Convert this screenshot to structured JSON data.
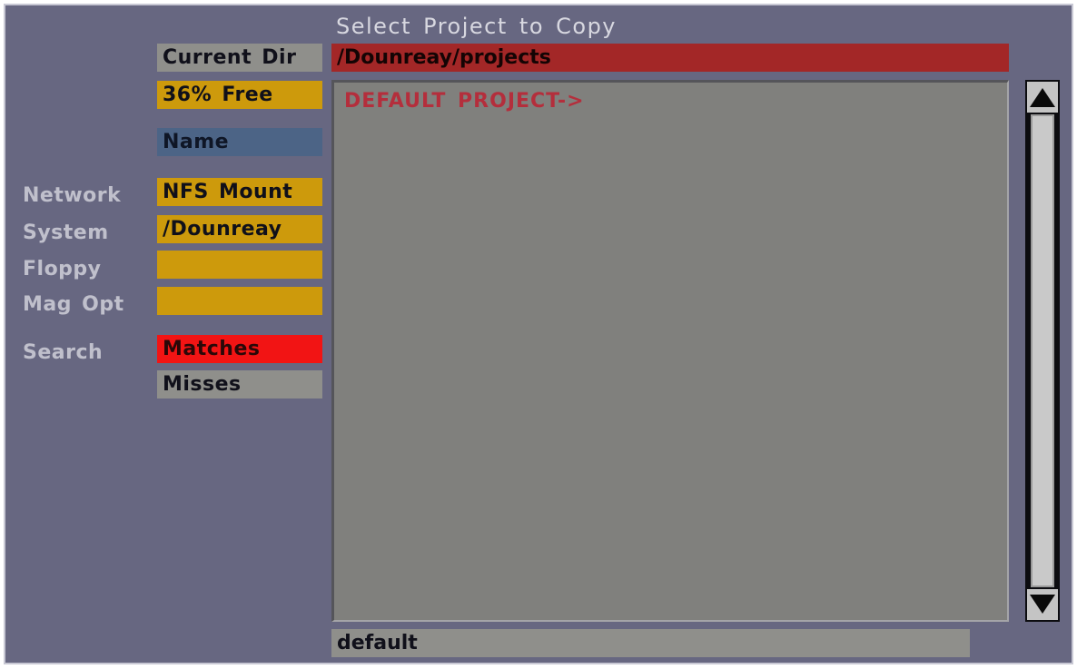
{
  "dialog": {
    "title": "Select Project to Copy",
    "current_dir_button": "Current Dir",
    "free_space": "36% Free",
    "name_button": "Name",
    "current_path": "/Dounreay/projects",
    "filename_value": "default"
  },
  "devices": [
    {
      "label": "Network",
      "value": "NFS Mount"
    },
    {
      "label": "System",
      "value": "/Dounreay"
    },
    {
      "label": "Floppy",
      "value": ""
    },
    {
      "label": "Mag Opt",
      "value": ""
    }
  ],
  "search": {
    "label": "Search",
    "options": [
      "Matches",
      "Misses"
    ],
    "selected": "Matches"
  },
  "project_list": [
    "DEFAULT PROJECT->"
  ],
  "scrollbar": {
    "up_icon": "triangle-up-icon",
    "down_icon": "triangle-down-icon"
  },
  "colors": {
    "background": "#676781",
    "path_bar": "#a32727",
    "device_button": "#cd9a0c",
    "search_selected": "#f21414",
    "list_text": "#b42e3c"
  }
}
